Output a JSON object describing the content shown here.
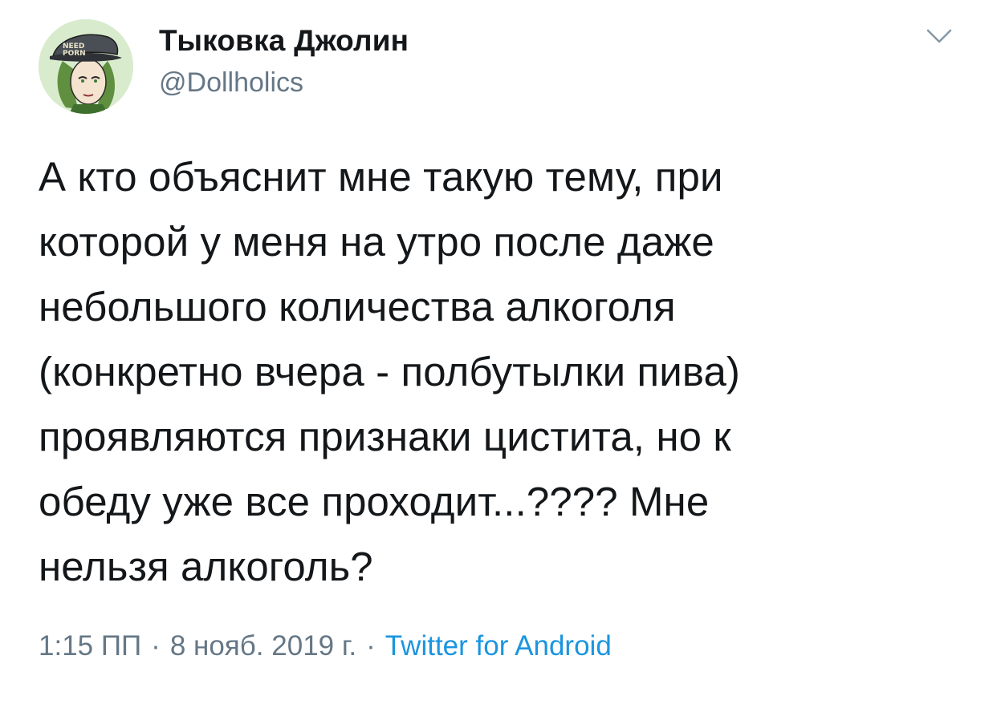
{
  "author": {
    "name": "Тыковка Джолин",
    "handle": "@Dollholics",
    "avatar_cap_text": "NEED PORN"
  },
  "menu": {
    "icon": "chevron-down-icon"
  },
  "tweet": {
    "text": "А кто объяснит мне такую тему, при\nкоторой у меня на утро после даже\nнебольшого количества алкоголя\n(конкретно вчера - полбутылки пива)\nпроявляются признаки цистита, но к\nобеду уже все проходит...????  Мне\nнельзя алкоголь?"
  },
  "meta": {
    "time": "1:15 ПП",
    "separator": "·",
    "date": "8 нояб. 2019 г.",
    "source": "Twitter for Android"
  },
  "colors": {
    "text": "#14171a",
    "muted": "#657786",
    "link": "#1b95e0",
    "avatar_bg": "#d8eccd"
  }
}
